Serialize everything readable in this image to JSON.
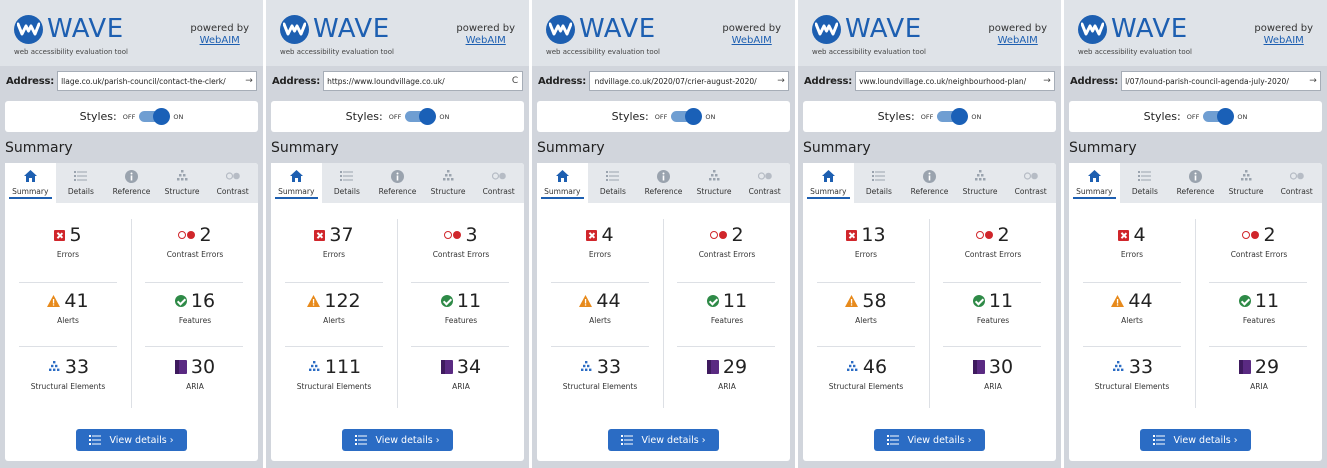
{
  "brand": {
    "name": "WAVE",
    "tagline": "web accessibility evaluation tool",
    "powered_by": "powered by",
    "provider": "WebAIM"
  },
  "common": {
    "address_label": "Address:",
    "styles_label": "Styles:",
    "styles_off": "OFF",
    "styles_on": "ON",
    "section_title": "Summary",
    "tabs": [
      "Summary",
      "Details",
      "Reference",
      "Structure",
      "Contrast"
    ],
    "labels": {
      "errors": "Errors",
      "contrast": "Contrast Errors",
      "alerts": "Alerts",
      "features": "Features",
      "structural": "Structural Elements",
      "aria": "ARIA"
    },
    "view_details": "View details ›"
  },
  "colors": {
    "brand_blue": "#1d5fb1",
    "error_red": "#d0262b",
    "alert_orange": "#e78a1c",
    "feature_green": "#2e8a47",
    "aria_purple": "#5a2a82",
    "structure_blue": "#2b6cc4"
  },
  "panels": [
    {
      "address": "llage.co.uk/parish-council/contact-the-clerk/",
      "action_icon": "arrow-right-icon",
      "action_glyph": "→",
      "errors": "5",
      "contrast": "2",
      "alerts": "41",
      "features": "16",
      "structural": "33",
      "aria": "30"
    },
    {
      "address": "https://www.loundvillage.co.uk/",
      "action_icon": "refresh-icon",
      "action_glyph": "C",
      "errors": "37",
      "contrast": "3",
      "alerts": "122",
      "features": "11",
      "structural": "111",
      "aria": "34"
    },
    {
      "address": " ndvillage.co.uk/2020/07/crier-august-2020/",
      "action_icon": "arrow-right-icon",
      "action_glyph": "→",
      "errors": "4",
      "contrast": "2",
      "alerts": "44",
      "features": "11",
      "structural": "33",
      "aria": "29"
    },
    {
      "address": "vww.loundvillage.co.uk/neighbourhood-plan/",
      "action_icon": "arrow-right-icon",
      "action_glyph": "→",
      "errors": "13",
      "contrast": "2",
      "alerts": "58",
      "features": "11",
      "structural": "46",
      "aria": "30"
    },
    {
      "address": "l/07/lound-parish-council-agenda-july-2020/",
      "action_icon": "arrow-right-icon",
      "action_glyph": "→",
      "errors": "4",
      "contrast": "2",
      "alerts": "44",
      "features": "11",
      "structural": "33",
      "aria": "29"
    }
  ]
}
